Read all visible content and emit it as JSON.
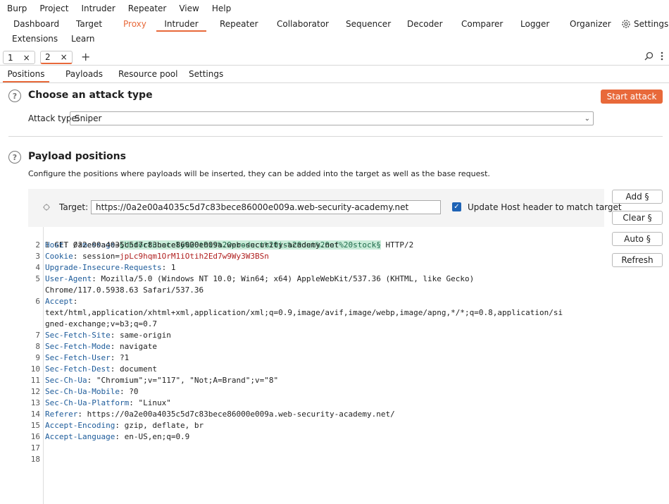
{
  "menu": [
    "Burp",
    "Project",
    "Intruder",
    "Repeater",
    "View",
    "Help"
  ],
  "tools_row1": [
    "Dashboard",
    "Target",
    "Proxy",
    "Intruder",
    "Repeater",
    "Collaborator",
    "Sequencer",
    "Decoder",
    "Comparer",
    "Logger",
    "Organizer",
    "Settings"
  ],
  "tools_row2": [
    "Extensions",
    "Learn"
  ],
  "subtabs": [
    {
      "label": "1",
      "close": "×"
    },
    {
      "label": "2",
      "close": "×"
    }
  ],
  "plus": "+",
  "inner_tabs": [
    "Positions",
    "Payloads",
    "Resource pool",
    "Settings"
  ],
  "attack_section": {
    "title": "Choose an attack type",
    "type_label": "Attack type:",
    "type_value": "Sniper",
    "start_button": "Start attack"
  },
  "payload_section": {
    "title": "Payload positions",
    "description": "Configure the positions where payloads will be inserted, they can be added into the target as well as the base request."
  },
  "target": {
    "label": "Target:",
    "value": "https://0a2e00a4035c5d7c83bece86000e009a.web-security-academy.net",
    "checkbox_label": "Update Host header to match target"
  },
  "side_buttons": [
    "Add §",
    "Clear §",
    "Auto §",
    "Refresh"
  ],
  "request": {
    "line1_pre": "GET /?",
    "line1_param": "message",
    "line1_eq": "=",
    "line1_payload": "§Unfortunately%20this%20product%20is%20out%20of%20stock§",
    "line1_post": " HTTP/2",
    "headers": [
      {
        "n": "2",
        "k": "Host",
        "v": " 0a2e00a4035c5d7c83bece86000e009a.web-security-academy.net"
      },
      {
        "n": "3",
        "k": "Cookie",
        "v": " session=",
        "cv": "jpLc9hqm1OrM1iOtih2Ed7w9Wy3W3BSn"
      },
      {
        "n": "4",
        "k": "Upgrade-Insecure-Requests",
        "v": " 1"
      },
      {
        "n": "5",
        "k": "User-Agent",
        "v": " Mozilla/5.0 (Windows NT 10.0; Win64; x64) AppleWebKit/537.36 (KHTML, like Gecko)"
      },
      {
        "n": "",
        "k": "",
        "v": "Chrome/117.0.5938.63 Safari/537.36"
      },
      {
        "n": "6",
        "k": "Accept",
        "v": ""
      },
      {
        "n": "",
        "k": "",
        "v": "text/html,application/xhtml+xml,application/xml;q=0.9,image/avif,image/webp,image/apng,*/*;q=0.8,application/si"
      },
      {
        "n": "",
        "k": "",
        "v": "gned-exchange;v=b3;q=0.7"
      },
      {
        "n": "7",
        "k": "Sec-Fetch-Site",
        "v": " same-origin"
      },
      {
        "n": "8",
        "k": "Sec-Fetch-Mode",
        "v": " navigate"
      },
      {
        "n": "9",
        "k": "Sec-Fetch-User",
        "v": " ?1"
      },
      {
        "n": "10",
        "k": "Sec-Fetch-Dest",
        "v": " document"
      },
      {
        "n": "11",
        "k": "Sec-Ch-Ua",
        "v": " \"Chromium\";v=\"117\", \"Not;A=Brand\";v=\"8\""
      },
      {
        "n": "12",
        "k": "Sec-Ch-Ua-Mobile",
        "v": " ?0"
      },
      {
        "n": "13",
        "k": "Sec-Ch-Ua-Platform",
        "v": " \"Linux\""
      },
      {
        "n": "14",
        "k": "Referer",
        "v": " https://0a2e00a4035c5d7c83bece86000e009a.web-security-academy.net/"
      },
      {
        "n": "15",
        "k": "Accept-Encoding",
        "v": " gzip, deflate, br"
      },
      {
        "n": "16",
        "k": "Accept-Language",
        "v": " en-US,en;q=0.9"
      },
      {
        "n": "17",
        "k": "",
        "v": ""
      },
      {
        "n": "18",
        "k": "",
        "v": ""
      }
    ]
  },
  "accent": "#e8693a"
}
